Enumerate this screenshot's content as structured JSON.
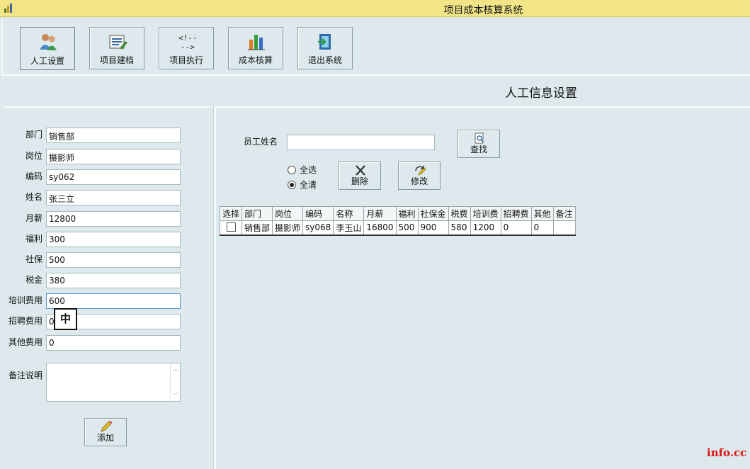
{
  "window": {
    "title": "项目成本核算系统"
  },
  "toolbar": {
    "buttons": [
      {
        "label": "人工设置",
        "icon": "users-icon"
      },
      {
        "label": "项目建档",
        "icon": "archive-icon"
      },
      {
        "label": "项目执行",
        "icon": "execute-icon"
      },
      {
        "label": "成本核算",
        "icon": "bar-chart-icon"
      },
      {
        "label": "退出系统",
        "icon": "exit-icon"
      }
    ]
  },
  "page": {
    "title": "人工信息设置"
  },
  "form": {
    "fields": [
      {
        "label": "部门",
        "value": "销售部"
      },
      {
        "label": "岗位",
        "value": "摄影师"
      },
      {
        "label": "编码",
        "value": "sy062"
      },
      {
        "label": "姓名",
        "value": "张三立"
      },
      {
        "label": "月薪",
        "value": "12800"
      },
      {
        "label": "福利",
        "value": "300"
      },
      {
        "label": "社保",
        "value": "500"
      },
      {
        "label": "税金",
        "value": "380"
      },
      {
        "label": "培训费用",
        "value": "600"
      },
      {
        "label": "招聘费用",
        "value": "0"
      },
      {
        "label": "其他费用",
        "value": "0"
      }
    ],
    "remarks_label": "备注说明",
    "remarks_value": "",
    "add_label": "添加",
    "ime_indicator": "中"
  },
  "search": {
    "label": "员工姓名",
    "value": "",
    "find_label": "查找",
    "select_all_label": "全选",
    "clear_all_label": "全清",
    "selected_option": "全清",
    "delete_label": "删除",
    "edit_label": "修改"
  },
  "grid": {
    "columns": [
      "选择",
      "部门",
      "岗位",
      "编码",
      "名称",
      "月薪",
      "福利",
      "社保金",
      "税费",
      "培训费",
      "招聘费",
      "其他",
      "备注"
    ],
    "rows": [
      [
        "",
        "销售部",
        "摄影师",
        "sy068",
        "李玉山",
        "16800",
        "500",
        "900",
        "580",
        "1200",
        "0",
        "0",
        ""
      ]
    ]
  },
  "watermark": "info.cc"
}
